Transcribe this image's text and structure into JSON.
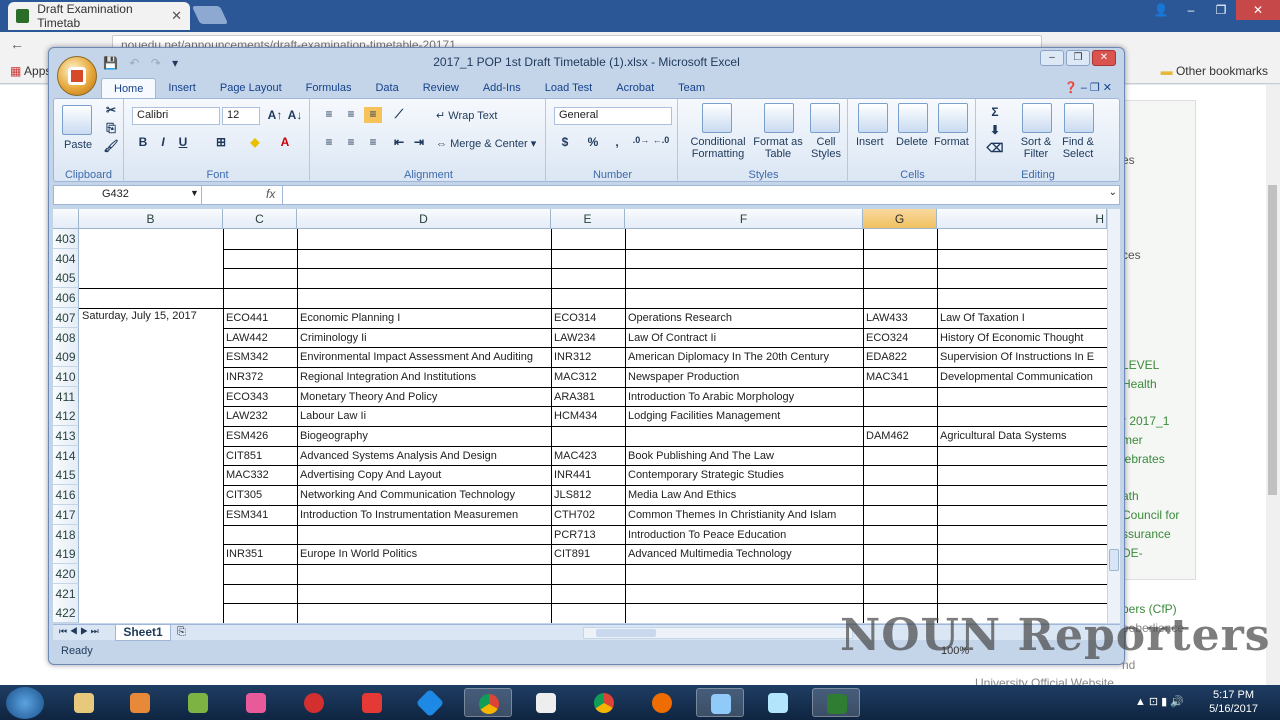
{
  "browser": {
    "tab_title": "Draft Examination Timetab",
    "url": "nouedu.net/announcements/draft-examination-timetable-20171",
    "apps_label": "Apps",
    "other_bookmarks": "Other bookmarks",
    "page_right_texts": [
      "es",
      "ces",
      "LEVEL",
      "Health",
      "r 2017_1",
      "mer",
      "lebrates",
      "ath",
      "Council for",
      "ssurance",
      "DE-",
      "pers (CfP)",
      "eeberlience",
      "nd",
      "University Official Website"
    ]
  },
  "excel": {
    "title": "2017_1 POP 1st Draft Timetable (1).xlsx - Microsoft Excel",
    "menu_tabs": [
      "Home",
      "Insert",
      "Page Layout",
      "Formulas",
      "Data",
      "Review",
      "Add-Ins",
      "Load Test",
      "Acrobat",
      "Team"
    ],
    "ribbon": {
      "paste": "Paste",
      "clipboard": "Clipboard",
      "font_name": "Calibri",
      "font_size": "12",
      "font": "Font",
      "wrap_text": "Wrap Text",
      "merge_center": "Merge & Center",
      "alignment": "Alignment",
      "number_format": "General",
      "number": "Number",
      "conditional_formatting": "Conditional Formatting",
      "format_as_table": "Format as Table",
      "cell_styles": "Cell Styles",
      "styles": "Styles",
      "insert": "Insert",
      "delete": "Delete",
      "format": "Format",
      "cells": "Cells",
      "sort_filter": "Sort & Filter",
      "find_select": "Find & Select",
      "editing": "Editing"
    },
    "name_box": "G432",
    "fx": "fx",
    "columns": [
      "B",
      "C",
      "D",
      "E",
      "F",
      "G",
      "H"
    ],
    "rows": [
      {
        "num": "403",
        "b": "",
        "c": "",
        "d": "",
        "e": "",
        "f": "",
        "g": "",
        "h": ""
      },
      {
        "num": "404",
        "b": "",
        "c": "",
        "d": "",
        "e": "",
        "f": "",
        "g": "",
        "h": ""
      },
      {
        "num": "405",
        "b": "",
        "c": "",
        "d": "",
        "e": "",
        "f": "",
        "g": "",
        "h": ""
      },
      {
        "num": "406",
        "b": "",
        "c": "",
        "d": "",
        "e": "",
        "f": "",
        "g": "",
        "h": ""
      },
      {
        "num": "407",
        "b": "Saturday, July 15, 2017",
        "c": "ECO441",
        "d": "Economic Planning I",
        "e": "ECO314",
        "f": "Operations Research",
        "g": "LAW433",
        "h": "Law Of Taxation I"
      },
      {
        "num": "408",
        "b": "",
        "c": "LAW442",
        "d": "Criminology Ii",
        "e": "LAW234",
        "f": "Law Of Contract Ii",
        "g": "ECO324",
        "h": "History Of Economic Thought"
      },
      {
        "num": "409",
        "b": "",
        "c": "ESM342",
        "d": "Environmental Impact Assessment And Auditing",
        "e": "INR312",
        "f": "American Diplomacy In The 20th Century",
        "g": "EDA822",
        "h": "Supervision Of Instructions In E"
      },
      {
        "num": "410",
        "b": "",
        "c": "INR372",
        "d": "Regional Integration And Institutions",
        "e": "MAC312",
        "f": "Newspaper Production",
        "g": "MAC341",
        "h": "Developmental Communication"
      },
      {
        "num": "411",
        "b": "",
        "c": "ECO343",
        "d": "Monetary Theory And Policy",
        "e": "ARA381",
        "f": "Introduction To Arabic Morphology",
        "g": "",
        "h": ""
      },
      {
        "num": "412",
        "b": "",
        "c": "LAW232",
        "d": "Labour Law Ii",
        "e": "HCM434",
        "f": "Lodging Facilities Management",
        "g": "",
        "h": ""
      },
      {
        "num": "413",
        "b": "",
        "c": "ESM426",
        "d": "Biogeography",
        "e": "",
        "f": "",
        "g": "DAM462",
        "h": "Agricultural Data Systems"
      },
      {
        "num": "414",
        "b": "",
        "c": "CIT851",
        "d": "Advanced Systems Analysis And Design",
        "e": "MAC423",
        "f": "Book Publishing And The Law",
        "g": "",
        "h": ""
      },
      {
        "num": "415",
        "b": "",
        "c": "MAC332",
        "d": "Advertising Copy And Layout",
        "e": "INR441",
        "f": "Contemporary Strategic Studies",
        "g": "",
        "h": ""
      },
      {
        "num": "416",
        "b": "",
        "c": "CIT305",
        "d": "Networking And Communication Technology",
        "e": "JLS812",
        "f": "Media Law And Ethics",
        "g": "",
        "h": ""
      },
      {
        "num": "417",
        "b": "",
        "c": "ESM341",
        "d": "Introduction To Instrumentation Measuremen",
        "e": "CTH702",
        "f": "Common Themes In Christianity And Islam",
        "g": "",
        "h": ""
      },
      {
        "num": "418",
        "b": "",
        "c": "",
        "d": "",
        "e": "PCR713",
        "f": "Introduction To Peace Education",
        "g": "",
        "h": ""
      },
      {
        "num": "419",
        "b": "",
        "c": "INR351",
        "d": "Europe In World Politics",
        "e": "CIT891",
        "f": "Advanced Multimedia Technology",
        "g": "",
        "h": ""
      },
      {
        "num": "420",
        "b": "",
        "c": "",
        "d": "",
        "e": "",
        "f": "",
        "g": "",
        "h": ""
      },
      {
        "num": "421",
        "b": "",
        "c": "",
        "d": "",
        "e": "",
        "f": "",
        "g": "",
        "h": ""
      },
      {
        "num": "422",
        "b": "",
        "c": "",
        "d": "",
        "e": "",
        "f": "",
        "g": "",
        "h": ""
      }
    ],
    "sheet_tab": "Sheet1",
    "status": "Ready",
    "zoom": "100%"
  },
  "watermark": "NOUN Reporters",
  "taskbar": {
    "time": "5:17 PM",
    "date": "5/16/2017"
  },
  "colors": {
    "selected_column": "#f1c15f",
    "excel_frame": "#c4d5ea",
    "taskbar": "#1f3d63"
  }
}
